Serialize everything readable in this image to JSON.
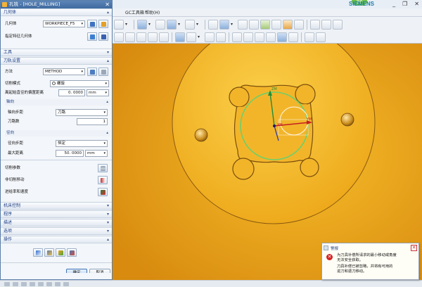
{
  "app": {
    "brand": "SIEMENS",
    "badge": "39",
    "window_controls": [
      "_",
      "❐",
      "✕"
    ]
  },
  "menubar": {
    "items": [
      "GC工具箱",
      "帮助(H)"
    ]
  },
  "dialog": {
    "title": "孔铣 - [HOLE_MILLING]",
    "close": "✕",
    "geometry": {
      "header": "几何体",
      "geometry_label": "几何体",
      "geometry_value": "WORKPIECE_F5",
      "feature_label": "指定特征几何体"
    },
    "tool": {
      "header": "工具"
    },
    "path": {
      "header": "刀轨设置",
      "method_label": "方法",
      "method_value": "METHOD",
      "cut_mode_label": "切削模式",
      "cut_mode_value": "螺旋",
      "distance_label": "离起始直径的偏置距离",
      "distance_value": "0. 0000",
      "distance_unit": "mm",
      "axial": {
        "header": "轴向",
        "step_label": "轴向步距",
        "step_value": "刀路",
        "count_label": "刀路数",
        "count_value": "1"
      },
      "radial": {
        "header": "径向",
        "step_label": "径向步距",
        "step_value": "恒定",
        "max_dist_label": "最大距离",
        "max_dist_value": "50. 0000",
        "max_dist_unit": "mm"
      },
      "cut_params_label": "切削参数",
      "noncut_label": "非切削移动",
      "feeds_label": "进给率和速度"
    },
    "sections": {
      "machine": "机床控制",
      "program": "程序",
      "description": "描述",
      "options": "选项",
      "actions": "操作"
    },
    "buttons": {
      "ok": "确定",
      "cancel": "取消"
    }
  },
  "viewport": {
    "axis_labels": {
      "zm": "ZM",
      "xm": "XM",
      "ym": "YM"
    }
  },
  "alarm": {
    "title": "警报",
    "close": "✕",
    "icon": "✕",
    "lines": [
      "为刀具补偿所请求的最小移动或角度",
      "无法安全获取。",
      "刀具补偿已被忽略，并将有可用的",
      "进刀和退刀移动。"
    ]
  },
  "colors": {
    "viewport_bg": "#e6a11a",
    "part": "#f6c126",
    "dialog_header": "#1f3f86",
    "circle": "#6fcf6a"
  }
}
